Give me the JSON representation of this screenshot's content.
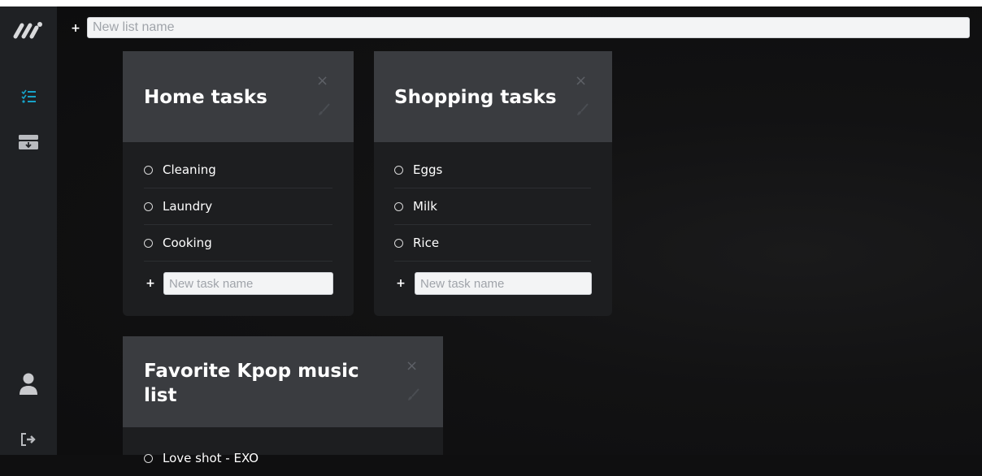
{
  "header": {
    "add_symbol": "+",
    "new_list_placeholder": "New list name"
  },
  "sidebar": {
    "items": [
      {
        "icon": "app-logo-icon"
      },
      {
        "icon": "checklist-icon",
        "active": true,
        "color": "#17a2c8"
      },
      {
        "icon": "archive-tray-icon"
      },
      {
        "icon": "user-icon"
      },
      {
        "icon": "logout-icon"
      }
    ]
  },
  "lists": [
    {
      "title": "Home tasks",
      "close_symbol": "×",
      "tasks": [
        "Cleaning",
        "Laundry",
        "Cooking"
      ],
      "new_task_placeholder": "New task name",
      "add_symbol": "+"
    },
    {
      "title": "Shopping tasks",
      "close_symbol": "×",
      "tasks": [
        "Eggs",
        "Milk",
        "Rice"
      ],
      "new_task_placeholder": "New task name",
      "add_symbol": "+"
    },
    {
      "title": "Favorite Kpop music list",
      "close_symbol": "×",
      "tasks": [
        "Love shot - EXO"
      ]
    }
  ],
  "colors": {
    "sidebar": "#1f2124",
    "card_header": "#3a3c40",
    "card_body": "#1d1e20",
    "accent": "#17a2c8"
  }
}
